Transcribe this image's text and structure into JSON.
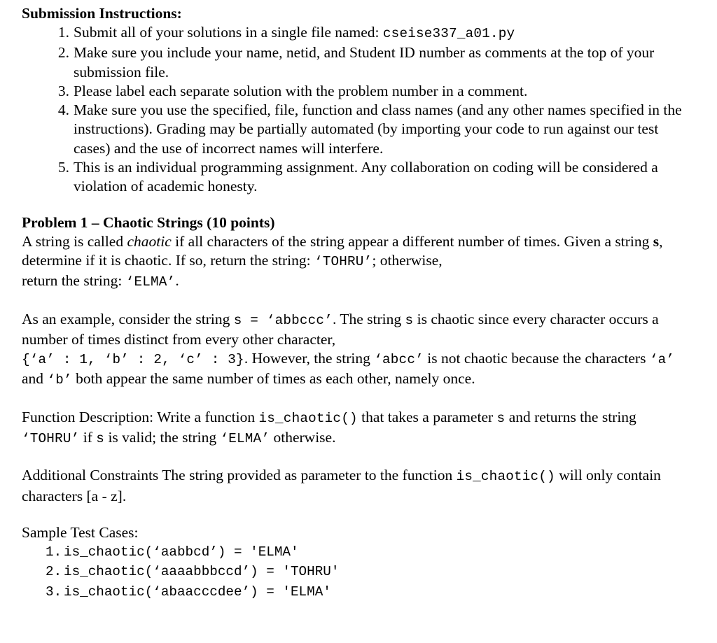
{
  "document": {
    "submission": {
      "heading": "Submission Instructions:",
      "items": [
        {
          "prefix": "Submit all of your solutions in a single file named: ",
          "code": "cseise337_a01.py",
          "suffix": ""
        },
        {
          "prefix": "Make sure you include your name, netid, and Student ID number as comments at the top of your submission file.",
          "code": "",
          "suffix": ""
        },
        {
          "prefix": "Please label each separate solution with the problem number in a comment.",
          "code": "",
          "suffix": ""
        },
        {
          "prefix": "Make sure you use the specified, file, function and class names (and any other names specified in the instructions).  Grading may be partially automated (by importing your code to run against our test cases) and the use of incorrect names will interfere.",
          "code": "",
          "suffix": ""
        },
        {
          "prefix": "This is an individual programming assignment. Any collaboration on coding will be considered a violation of academic honesty.",
          "code": "",
          "suffix": ""
        }
      ]
    },
    "problem": {
      "heading": "Problem 1 – Chaotic Strings (10 points)",
      "definition": {
        "t1": "A string is called ",
        "italic": "chaotic",
        "t2": " if all characters of the string appear a different number of times. Given a string ",
        "bold_s": "s",
        "t3": ", determine if it is chaotic. If so, return the string: ",
        "code_tohru": "‘TOHRU’",
        "t4": "; otherwise,"
      },
      "definition_line2": {
        "t1": "return the string: ",
        "code_elma": "‘ELMA’",
        "t2": "."
      },
      "example": {
        "t1": "As an example, consider the string ",
        "code_s_eq": "s  =  ‘abbccc’",
        "t2": ". The string ",
        "code_s": "s",
        "t3": " is chaotic since every character occurs a number of times distinct from every other character,"
      },
      "example_line2": {
        "code_dict": "{‘a’ : 1, ‘b’ : 2, ‘c’ : 3}",
        "t1": ". However, the string ",
        "code_abcc": "‘abcc’",
        "t2": " is not chaotic because the characters ",
        "code_a": "‘a’",
        "t3": " and ",
        "code_b": "‘b’",
        "t4": " both appear the same number of times as each other, namely once."
      },
      "function_description": {
        "t1": "Function Description: Write a function ",
        "code_fn": "is_chaotic()",
        "t2": " that takes a parameter ",
        "code_s": "s",
        "t3": " and returns the string ",
        "code_tohru": "‘TOHRU’",
        "t4": " if ",
        "code_s2": "s",
        "t5": " is valid; the string ",
        "code_elma": "‘ELMA’",
        "t6": " otherwise."
      },
      "constraints": {
        "t1": "Additional Constraints The string provided as parameter to the function ",
        "code_fn": "is_chaotic()",
        "t2": " will only contain characters [a - z]."
      },
      "samples": {
        "heading": "Sample Test Cases:",
        "cases": [
          "is_chaotic(‘aabbcd’) = 'ELMA'",
          "is_chaotic(‘aaaabbbccd’) = 'TOHRU'",
          "is_chaotic(‘abaacccdee’) = 'ELMA'"
        ]
      }
    }
  }
}
